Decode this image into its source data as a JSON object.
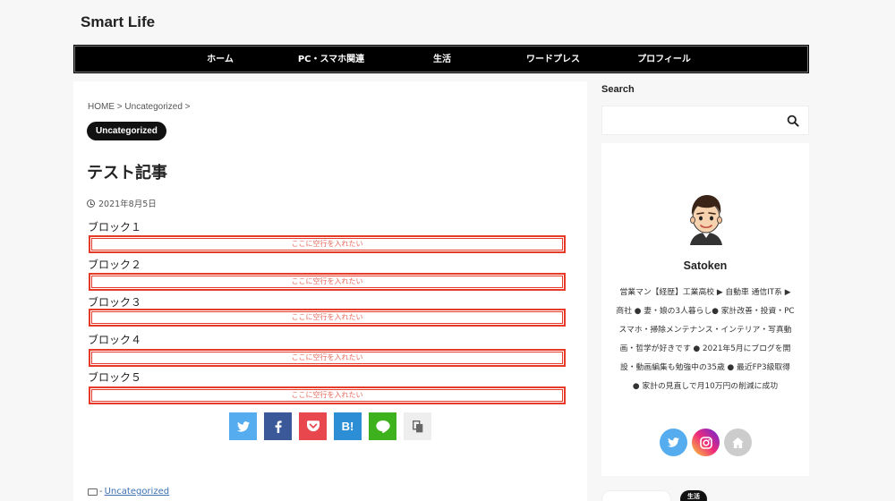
{
  "site": {
    "title": "Smart Life"
  },
  "nav": {
    "items": [
      {
        "label": "ホーム"
      },
      {
        "label": "PC・スマホ関連"
      },
      {
        "label": "生活"
      },
      {
        "label": "ワードプレス"
      },
      {
        "label": "プロフィール"
      }
    ]
  },
  "breadcrumb": {
    "home": "HOME",
    "category": "Uncategorized",
    "sep": ">"
  },
  "post": {
    "category": "Uncategorized",
    "title": "テスト記事",
    "date": "2021年8月5日",
    "blocks": [
      {
        "label": "ブロック１",
        "box_text": "ここに空行を入れたい"
      },
      {
        "label": "ブロック２",
        "box_text": "ここに空行を入れたい"
      },
      {
        "label": "ブロック３",
        "box_text": "ここに空行を入れたい"
      },
      {
        "label": "ブロック４",
        "box_text": "ここに空行を入れたい"
      },
      {
        "label": "ブロック５",
        "box_text": "ここに空行を入れたい"
      }
    ],
    "footer_category_prefix": "-",
    "footer_category": "Uncategorized"
  },
  "share": {
    "buttons": [
      {
        "name": "twitter",
        "icon": "twitter-bird-icon",
        "color": "#55acee"
      },
      {
        "name": "facebook",
        "icon": "facebook-f-icon",
        "color": "#3b5998"
      },
      {
        "name": "pocket",
        "icon": "pocket-icon",
        "color": "#e8474e"
      },
      {
        "name": "hatena",
        "icon": "hatena-bookmark-icon",
        "color": "#2c8fd6",
        "glyph": "B!"
      },
      {
        "name": "line",
        "icon": "line-chat-icon",
        "color": "#3db21c"
      },
      {
        "name": "copy",
        "icon": "copy-icon",
        "color": "#eeeeee"
      }
    ]
  },
  "sidebar": {
    "search_heading": "Search",
    "search_placeholder": "",
    "profile": {
      "name": "Satoken",
      "bio": "営業マン【経歴】工業高校 ▶ 自動車 通信IT系 ▶ 商社 ● 妻・娘の3人暮らし● 家計改善・投資・PCスマホ・掃除メンテナンス・インテリア・写真動画・哲学が好きです ● 2021年5月にブログを開設・動画編集も勉強中の35歳 ● 最近FP3級取得 ● 家計の見直しで月10万円の削減に成功",
      "social": [
        {
          "name": "twitter",
          "icon": "twitter-bird-icon",
          "color": "#55acee"
        },
        {
          "name": "instagram",
          "icon": "instagram-icon",
          "color": "#d6249f"
        },
        {
          "name": "home",
          "icon": "home-icon",
          "color": "#cccccc"
        }
      ]
    },
    "tag": "生活"
  }
}
